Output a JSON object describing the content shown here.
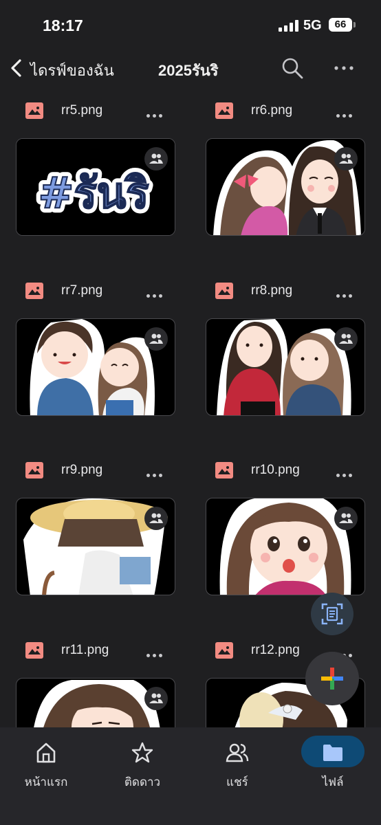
{
  "status_bar": {
    "time": "18:17",
    "network": "5G",
    "battery": "66"
  },
  "header": {
    "back_label": "ไดรฟ์ของฉัน",
    "title": "2025รันริ"
  },
  "files": [
    {
      "name": "rr5.png",
      "shared": true
    },
    {
      "name": "rr6.png",
      "shared": true
    },
    {
      "name": "rr7.png",
      "shared": true
    },
    {
      "name": "rr8.png",
      "shared": true
    },
    {
      "name": "rr9.png",
      "shared": true
    },
    {
      "name": "rr10.png",
      "shared": true
    },
    {
      "name": "rr11.png",
      "shared": true
    },
    {
      "name": "rr12.png",
      "shared": false
    }
  ],
  "thumb_text": {
    "rr5": "#รันริ"
  },
  "bottom_nav": {
    "home": "หน้าแรก",
    "starred": "ติดดาว",
    "shared": "แชร์",
    "files": "ไฟล์"
  },
  "colors": {
    "background": "#1f1f21",
    "file_icon": "#f28b82",
    "active_pill": "#0e4a75",
    "accent_blue": "#8ab4f8"
  },
  "icons": {
    "back": "chevron-left-icon",
    "search": "search-icon",
    "more": "more-horizontal-icon",
    "file": "image-file-icon",
    "shared": "people-icon",
    "scan": "document-scan-icon",
    "new": "google-plus-icon"
  }
}
